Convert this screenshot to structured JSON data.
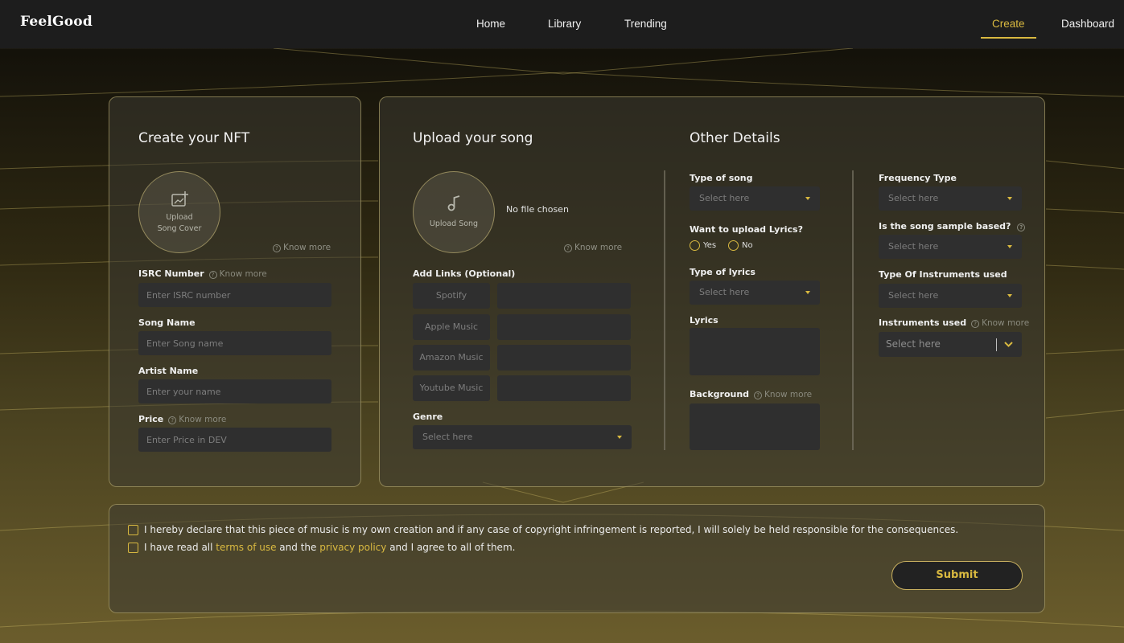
{
  "nav": {
    "logo": "FeelGood",
    "home": "Home",
    "library": "Library",
    "trending": "Trending",
    "create": "Create",
    "dashboard": "Dashboard"
  },
  "nft": {
    "title": "Create your NFT",
    "cover_upload_line1": "Upload",
    "cover_upload_line2": "Song Cover",
    "know_more": "Know more",
    "isrc_label": "ISRC Number",
    "isrc_placeholder": "Enter ISRC number",
    "song_name_label": "Song Name",
    "song_name_placeholder": "Enter Song name",
    "artist_label": "Artist Name",
    "artist_placeholder": "Enter your name",
    "price_label": "Price",
    "price_placeholder": "Enter Price in DEV"
  },
  "song": {
    "title": "Upload your song",
    "upload_label": "Upload Song",
    "file_status": "No file chosen",
    "know_more": "Know more",
    "links_label": "Add Links (Optional)",
    "links": [
      "Spotify",
      "Apple Music",
      "Amazon Music",
      "Youtube Music"
    ],
    "genre_label": "Genre",
    "genre_placeholder": "Select here"
  },
  "details": {
    "title": "Other Details",
    "type_of_song_label": "Type of song",
    "type_of_song_placeholder": "Select here",
    "lyrics_upload_label": "Want to upload Lyrics?",
    "yes": "Yes",
    "no": "No",
    "type_of_lyrics_label": "Type of lyrics",
    "type_of_lyrics_placeholder": "Select here",
    "lyrics_label": "Lyrics",
    "background_label": "Background",
    "know_more": "Know more",
    "frequency_label": "Frequency Type",
    "frequency_placeholder": "Select here",
    "sample_label": "Is the song sample based?",
    "sample_placeholder": "Select here",
    "instrument_type_label": "Type Of Instruments used",
    "instrument_type_placeholder": "Select here",
    "instruments_used_label": "Instruments used",
    "instruments_used_placeholder": "Select here"
  },
  "declaration": {
    "line1": "I hereby declare that this piece of music is my own creation and if any case of copyright infringement is reported, I will solely be held responsible for the consequences.",
    "line2_a": "I have read all ",
    "terms": "terms of use",
    "line2_b": " and the ",
    "privacy": "privacy policy",
    "line2_c": " and I agree to all of them.",
    "submit": "Submit"
  },
  "colors": {
    "accent": "#d9b940",
    "field_bg": "#2f2f2f",
    "nav_bg": "#1d1d1d"
  }
}
